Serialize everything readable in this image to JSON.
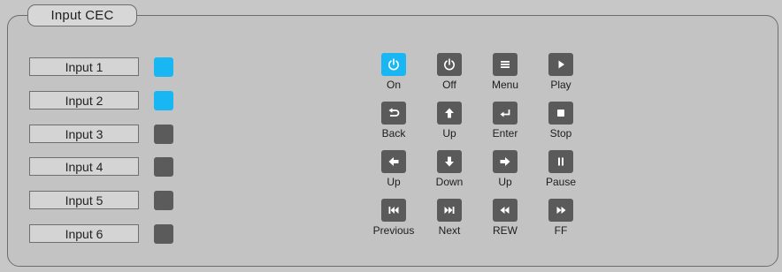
{
  "panel": {
    "title": "Input CEC"
  },
  "inputs": [
    {
      "label": "Input 1",
      "active": true
    },
    {
      "label": "Input 2",
      "active": true
    },
    {
      "label": "Input 3",
      "active": false
    },
    {
      "label": "Input 4",
      "active": false
    },
    {
      "label": "Input 5",
      "active": false
    },
    {
      "label": "Input 6",
      "active": false
    }
  ],
  "controls": [
    {
      "label": "On",
      "icon": "power-icon",
      "active": true
    },
    {
      "label": "Off",
      "icon": "power-icon",
      "active": false
    },
    {
      "label": "Menu",
      "icon": "menu-icon",
      "active": false
    },
    {
      "label": "Play",
      "icon": "play-icon",
      "active": false
    },
    {
      "label": "Back",
      "icon": "back-icon",
      "active": false
    },
    {
      "label": "Up",
      "icon": "arrow-up-icon",
      "active": false
    },
    {
      "label": "Enter",
      "icon": "enter-icon",
      "active": false
    },
    {
      "label": "Stop",
      "icon": "stop-icon",
      "active": false
    },
    {
      "label": "Up",
      "icon": "arrow-left-icon",
      "active": false
    },
    {
      "label": "Down",
      "icon": "arrow-down-icon",
      "active": false
    },
    {
      "label": "Up",
      "icon": "arrow-right-icon",
      "active": false
    },
    {
      "label": "Pause",
      "icon": "pause-icon",
      "active": false
    },
    {
      "label": "Previous",
      "icon": "previous-icon",
      "active": false
    },
    {
      "label": "Next",
      "icon": "next-icon",
      "active": false
    },
    {
      "label": "REW",
      "icon": "rewind-icon",
      "active": false
    },
    {
      "label": "FF",
      "icon": "fast-forward-icon",
      "active": false
    }
  ],
  "colors": {
    "active": "#18b7f3",
    "inactive": "#5a5a5a"
  }
}
